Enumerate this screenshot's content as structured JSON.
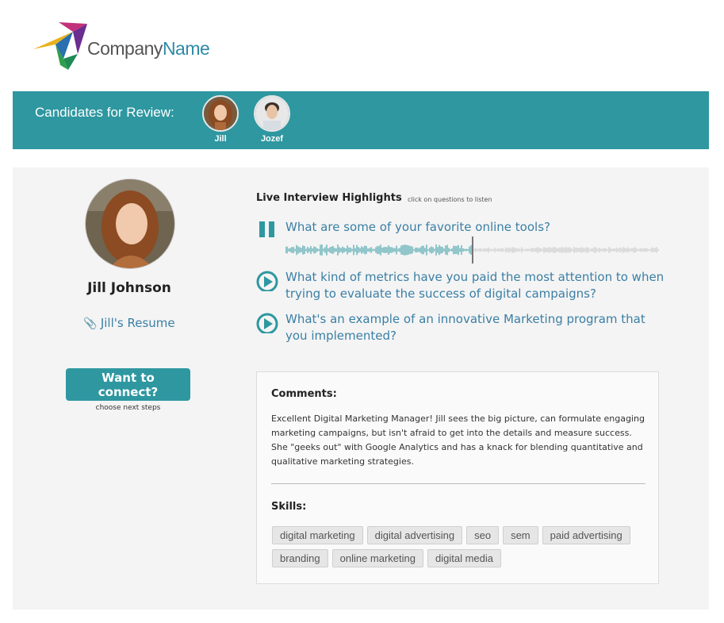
{
  "brand": {
    "name_part1": "Company",
    "name_part2": "Name"
  },
  "header": {
    "title": "Candidates for Review:",
    "candidates": [
      {
        "name": "Jill"
      },
      {
        "name": "Jozef"
      }
    ]
  },
  "profile": {
    "name": "Jill Johnson",
    "resume_label": "Jill's Resume",
    "connect_label": "Want to connect?",
    "connect_hint": "choose next steps"
  },
  "highlights": {
    "title": "Live Interview Highlights",
    "hint": "click on questions to listen",
    "questions": [
      {
        "text": "What are some of your favorite online tools?",
        "state": "playing",
        "icon": "pause-icon",
        "progress": 0.5
      },
      {
        "text": "What kind of metrics have you paid the most attention to when trying to evaluate the success of digital campaigns?",
        "state": "idle",
        "icon": "play-icon"
      },
      {
        "text": "What's an example of an innovative Marketing program that you implemented?",
        "state": "idle",
        "icon": "play-icon"
      }
    ]
  },
  "comments": {
    "heading": "Comments:",
    "body": "Excellent Digital Marketing Manager! Jill sees the big picture, can formulate engaging marketing campaigns, but isn't afraid to get into the details and measure success. She \"geeks out\" with Google Analytics and has a knack for blending quantitative and qualitative marketing strategies.",
    "skills_heading": "Skills:",
    "skills": [
      "digital marketing",
      "digital advertising",
      "seo",
      "sem",
      "paid advertising",
      "branding",
      "online marketing",
      "digital media"
    ]
  },
  "colors": {
    "teal": "#2e97a0",
    "link": "#3a7fa5"
  }
}
